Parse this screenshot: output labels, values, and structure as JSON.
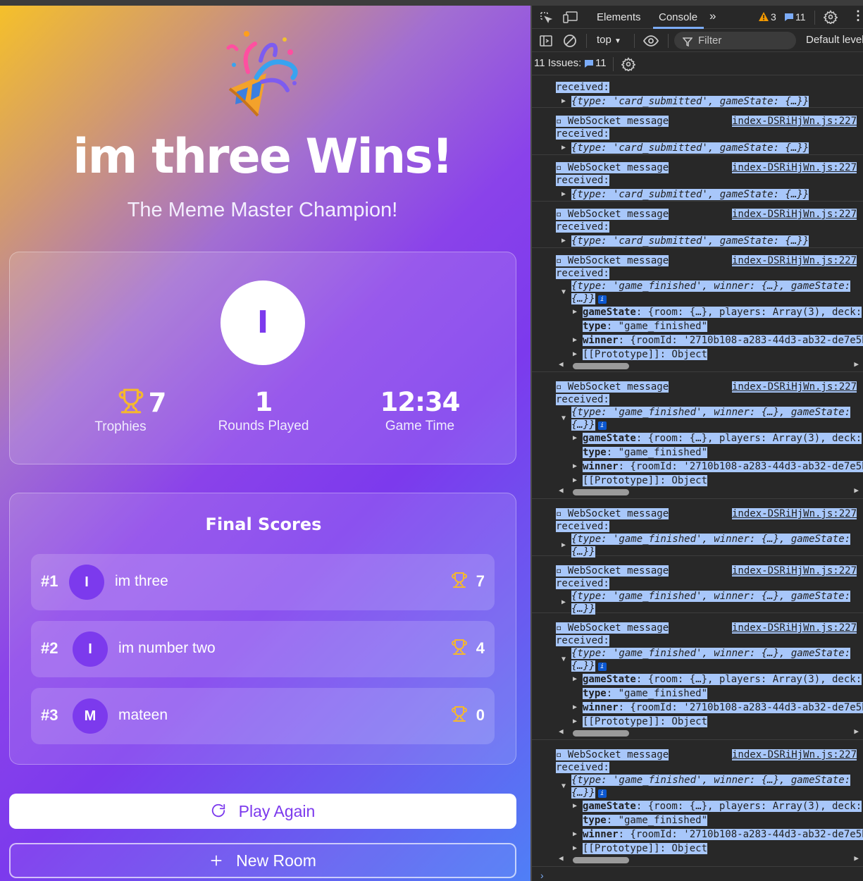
{
  "game": {
    "win_title": "im three Wins!",
    "subtitle": "The Meme Master Champion!",
    "champion_initial": "I",
    "stats": [
      {
        "value": "7",
        "label": "Trophies",
        "icon": "trophy-icon"
      },
      {
        "value": "1",
        "label": "Rounds Played"
      },
      {
        "value": "12:34",
        "label": "Game Time"
      }
    ],
    "scores_title": "Final Scores",
    "players": [
      {
        "rank": "#1",
        "initial": "I",
        "name": "im three",
        "trophies": "7"
      },
      {
        "rank": "#2",
        "initial": "I",
        "name": "im number two",
        "trophies": "4"
      },
      {
        "rank": "#3",
        "initial": "M",
        "name": "mateen",
        "trophies": "0"
      }
    ],
    "play_again_label": "Play Again",
    "new_room_label": "New Room",
    "colors": {
      "accent": "#7c3aed",
      "trophy": "#f5b82e"
    }
  },
  "devtools": {
    "tabs": [
      "Elements",
      "Console"
    ],
    "active_tab": "Console",
    "warnings_count": "3",
    "issues_count": "11",
    "context": "top",
    "filter_placeholder": "Filter",
    "levels_label": "Default levels",
    "issues_label": "11 Issues:",
    "issues_badge": "11",
    "log_label": "WebSocket message",
    "log_label2": "received:",
    "source": "index-DSRiHjWn.js:227",
    "card_obj": "{type: 'card_submitted', gameState: {…}}",
    "finished_obj": "{type: 'game_finished', winner: {…}, gameState:",
    "finished_tail": "{…}}",
    "prop_gamestate_key": "gameState",
    "prop_gamestate_val": ": {room: {…}, players: Array(3), deck:",
    "prop_type_key": "type",
    "prop_type_val": ": \"game_finished\"",
    "prop_winner_key": "winner",
    "prop_winner_val": ": {roomId: '2710b108-a283-44d3-ab32-de7e5b",
    "prop_proto": "[[Prototype]]: Object"
  }
}
